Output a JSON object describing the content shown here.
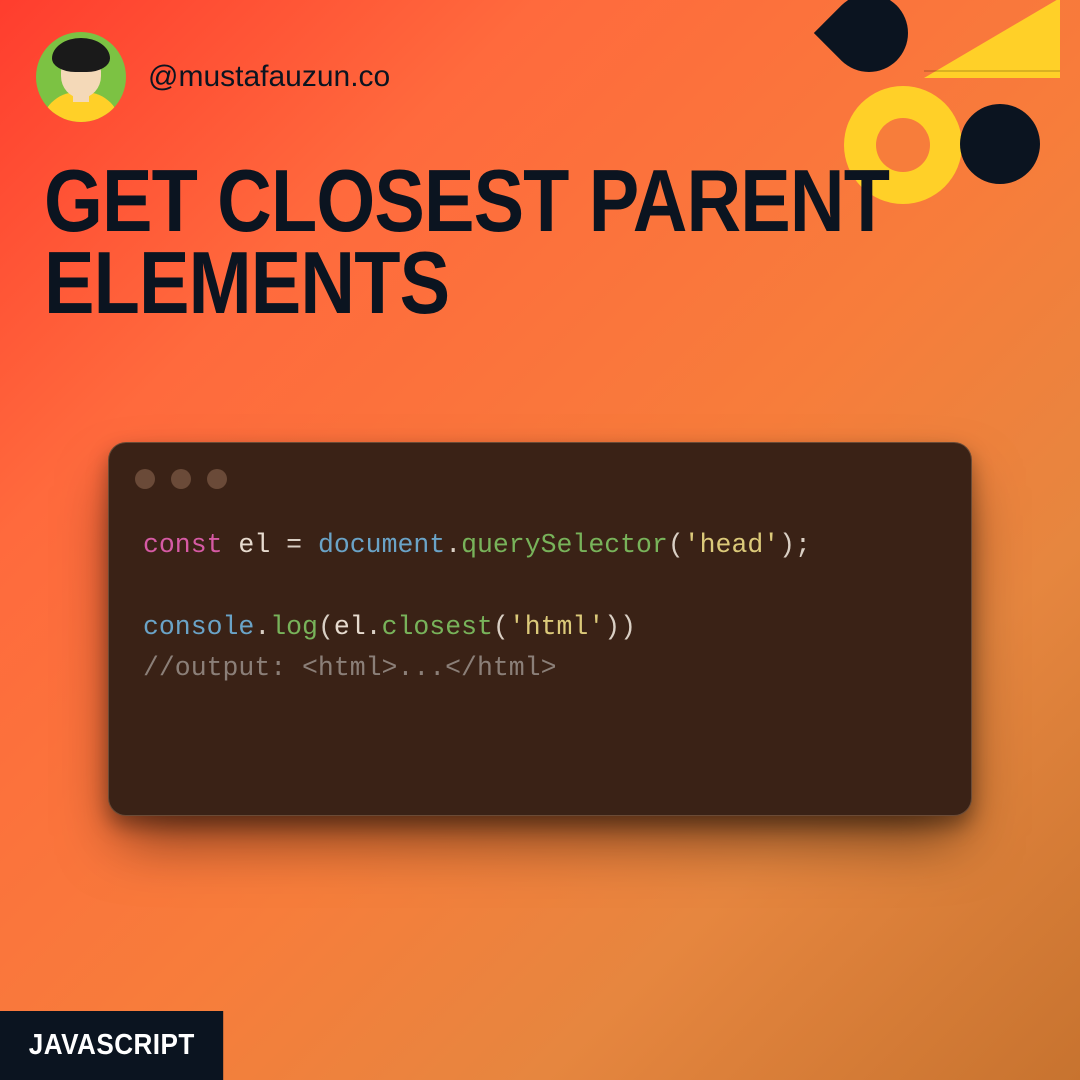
{
  "header": {
    "handle": "@mustafauzun.co"
  },
  "title": {
    "line1": "GET CLOSEST PARENT",
    "line2": "ELEMENTS"
  },
  "code": {
    "line1": {
      "kw": "const",
      "var": "el",
      "eq": "=",
      "obj": "document",
      "dot": ".",
      "fn": "querySelector",
      "open": "(",
      "str": "'head'",
      "close": ");"
    },
    "line2": {
      "obj": "console",
      "dot1": ".",
      "fn1": "log",
      "open1": "(",
      "var": "el",
      "dot2": ".",
      "fn2": "closest",
      "open2": "(",
      "str": "'html'",
      "close2": ")",
      "close1": ")"
    },
    "line3": "//output: <html>...</html>"
  },
  "tag": "JAVASCRIPT",
  "colors": {
    "brandDark": "#0b1420",
    "brandYellow": "#ffd028",
    "cardBg": "#3a2216"
  }
}
